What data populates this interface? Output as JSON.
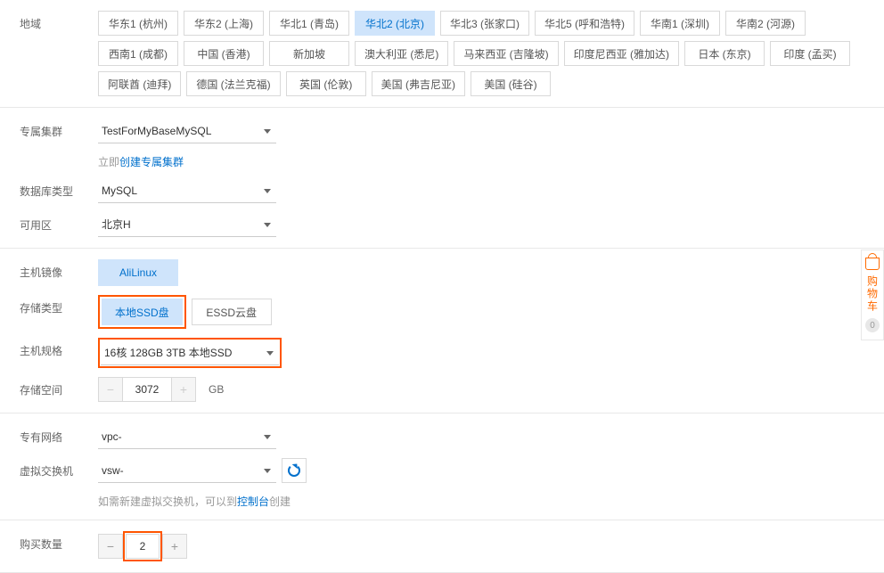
{
  "labels": {
    "region": "地域",
    "cluster": "专属集群",
    "dbtype": "数据库类型",
    "zone": "可用区",
    "image": "主机镜像",
    "storage": "存储类型",
    "spec": "主机规格",
    "space": "存储空间",
    "vpc": "专有网络",
    "vswitch": "虚拟交换机",
    "qty": "购买数量"
  },
  "regions": {
    "row1": [
      "华东1 (杭州)",
      "华东2 (上海)",
      "华北1 (青岛)",
      "华北2 (北京)",
      "华北3 (张家口)",
      "华北5 (呼和浩特)",
      "华南1 (深圳)",
      "华南2 (河源)"
    ],
    "row2": [
      "西南1 (成都)",
      "中国 (香港)",
      "新加坡",
      "澳大利亚 (悉尼)",
      "马来西亚 (吉隆坡)",
      "印度尼西亚 (雅加达)",
      "日本 (东京)",
      "印度 (孟买)"
    ],
    "row3": [
      "阿联酋 (迪拜)",
      "德国 (法兰克福)",
      "英国 (伦敦)",
      "美国 (弗吉尼亚)",
      "美国 (硅谷)"
    ],
    "selected": "华北2 (北京)"
  },
  "cluster": {
    "value": "TestForMyBaseMySQL",
    "hint_prefix": "立即",
    "hint_link": "创建专属集群"
  },
  "dbtype": {
    "value": "MySQL"
  },
  "zone": {
    "value": "北京H"
  },
  "image": {
    "options": [
      "AliLinux"
    ],
    "selected": "AliLinux"
  },
  "storage": {
    "options": [
      "本地SSD盘",
      "ESSD云盘"
    ],
    "selected": "本地SSD盘"
  },
  "spec": {
    "value": "16核 128GB 3TB 本地SSD"
  },
  "space": {
    "value": "3072",
    "unit": "GB"
  },
  "vpc": {
    "value": "vpc-"
  },
  "vswitch": {
    "value": "vsw-",
    "hint_prefix": "如需新建虚拟交换机，可以到",
    "hint_link": "控制台",
    "hint_suffix": "创建"
  },
  "qty": {
    "value": "2"
  },
  "cart": {
    "label": "购物车",
    "count": "0"
  }
}
